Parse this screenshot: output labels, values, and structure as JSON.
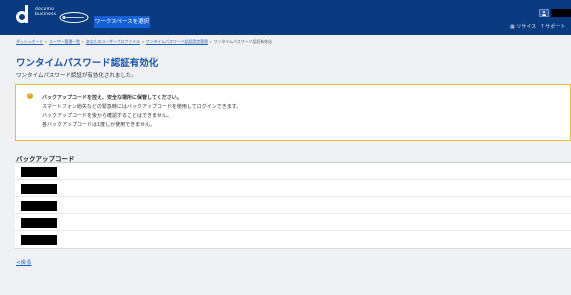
{
  "header": {
    "brand_line1": "docomo",
    "brand_line2": "business",
    "workspace_button": "ワークスペースを選択",
    "links": [
      "リサイス",
      "サポート"
    ],
    "accent_color": "#0a3a80"
  },
  "breadcrumb": {
    "items": [
      "ダッシュボード",
      "ユーザー管理一覧",
      "あなたのユーザープロファイル",
      "ワンタイムパスワード認証設定管理"
    ],
    "current": "ワンタイムパスワード認証有効化",
    "separator": ">"
  },
  "page": {
    "title": "ワンタイムパスワード認証有効化",
    "subtitle": "ワンタイムパスワード認証が有効化されました。"
  },
  "warning": {
    "icon": "exclamation-icon",
    "title": "バックアップコードを控え、安全な場所に保管してください。",
    "lines": [
      "スマートフォン紛失などの緊急時にはバックアップコードを使用してログインできます。",
      "バックアップコードを後から確認することはできません。",
      "各バックアップコードは1度しか使用できません。"
    ],
    "border_color": "#e8bf3a"
  },
  "backup": {
    "title": "バックアップコード",
    "codes_count": 5
  },
  "back_link": "<戻る"
}
